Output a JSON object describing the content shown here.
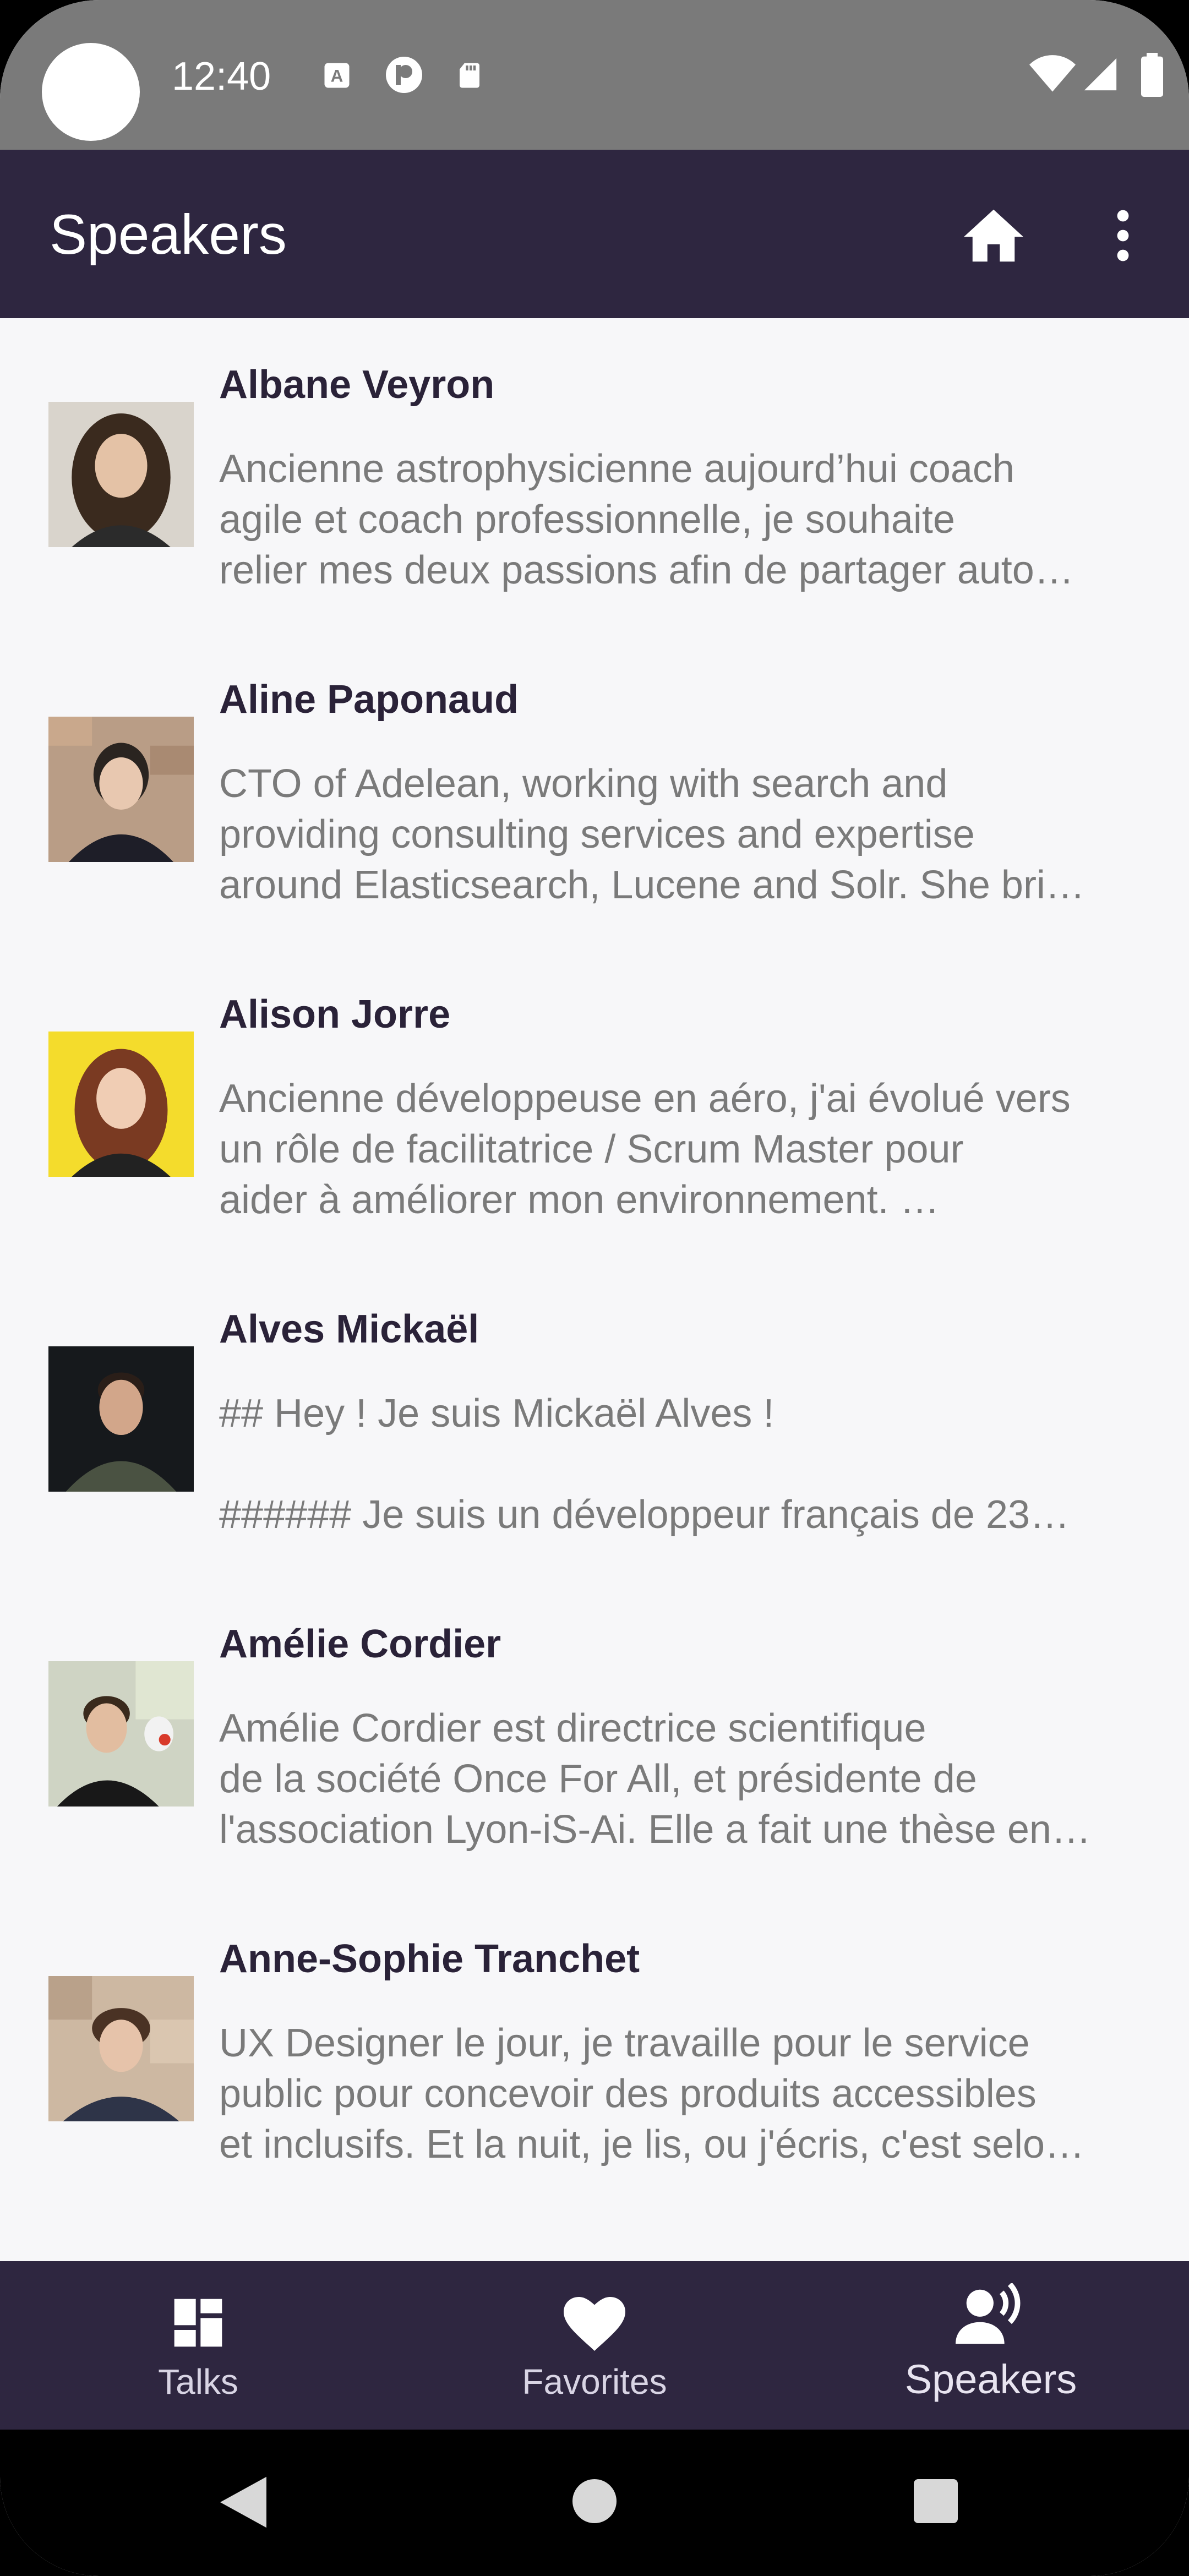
{
  "status_bar": {
    "time": "12:40",
    "icons": [
      "a-icon",
      "p-icon",
      "sd-card-icon",
      "wifi-icon",
      "signal-icon",
      "battery-icon"
    ]
  },
  "app_bar": {
    "title": "Speakers",
    "actions": [
      "home-icon",
      "more-vert-icon"
    ]
  },
  "speakers": [
    {
      "name": "Albane Veyron",
      "bio": [
        "Ancienne astrophysicienne aujourd’hui coach",
        "agile et coach professionnelle, je souhaite",
        "relier mes deux passions afin de partager auto…"
      ]
    },
    {
      "name": "Aline Paponaud",
      "bio": [
        "CTO of Adelean, working with search and",
        "providing consulting services and expertise",
        "around Elasticsearch, Lucene and Solr. She bri…"
      ]
    },
    {
      "name": "Alison Jorre",
      "bio": [
        "Ancienne développeuse en aéro, j'ai évolué vers",
        "un rôle de facilitatrice / Scrum Master pour",
        "aider à améliorer mon environnement. …"
      ]
    },
    {
      "name": "Alves Mickaël",
      "bio": [
        "## Hey ! Je suis Mickaël Alves !",
        "",
        "###### Je suis un développeur français de 23…"
      ]
    },
    {
      "name": "Amélie Cordier",
      "bio": [
        "Amélie Cordier est directrice scientifique",
        "de la société Once For All, et présidente de",
        "l'association Lyon-iS-Ai. Elle a fait une thèse en…"
      ]
    },
    {
      "name": "Anne-Sophie Tranchet",
      "bio": [
        "UX Designer le jour, je travaille pour le service",
        "public pour concevoir des produits accessibles",
        "et inclusifs. Et la nuit, je lis, ou j'écris, c'est selo…"
      ]
    }
  ],
  "bottom_nav": {
    "items": [
      {
        "label": "Talks",
        "icon": "dashboard-icon",
        "selected": false
      },
      {
        "label": "Favorites",
        "icon": "heart-icon",
        "selected": false
      },
      {
        "label": "Speakers",
        "icon": "speaker-voice-icon",
        "selected": true
      }
    ]
  },
  "system_nav": [
    "back-icon",
    "home-circle-icon",
    "recents-icon"
  ],
  "colors": {
    "app_bar": "#2e2640",
    "background": "#f7f7f9",
    "status_bar": "#7a7a7a",
    "name_text": "#2a2238",
    "bio_text": "#7a7a7a"
  }
}
